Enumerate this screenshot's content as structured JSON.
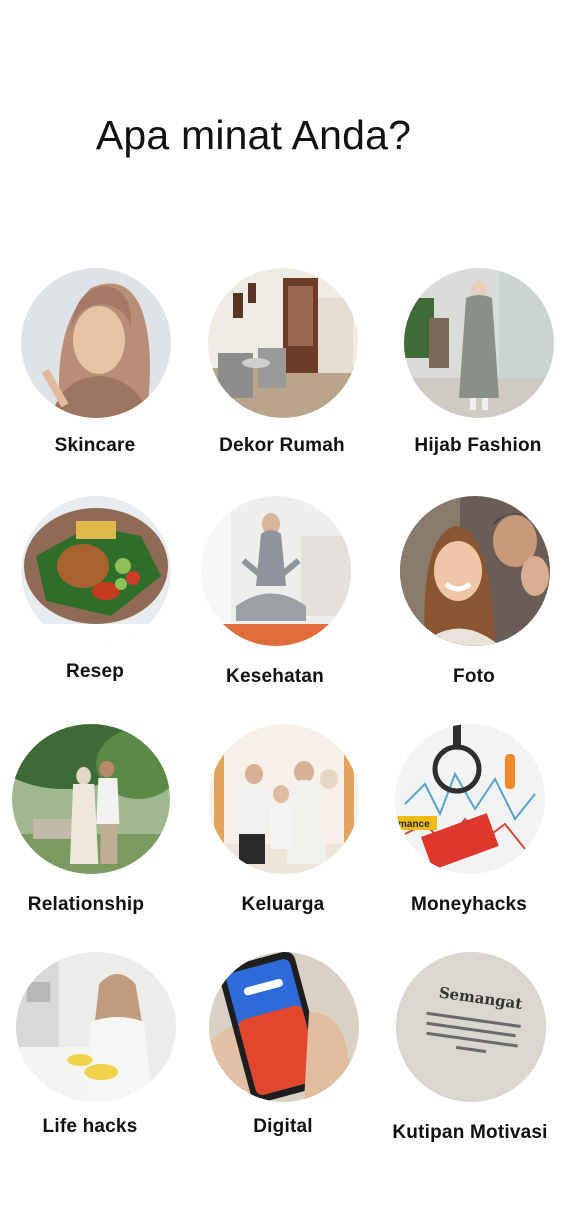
{
  "page": {
    "title": "Apa minat Anda?"
  },
  "interests": [
    {
      "label": "Skincare",
      "image": "woman-hijab-skincare-photo"
    },
    {
      "label": "Dekor Rumah",
      "image": "living-room-decor-photo"
    },
    {
      "label": "Hijab Fashion",
      "image": "hijab-fashion-model-photo"
    },
    {
      "label": "Resep",
      "image": "fried-chicken-dish-photo"
    },
    {
      "label": "Kesehatan",
      "image": "woman-meditating-photo"
    },
    {
      "label": "Foto",
      "image": "smiling-friends-photo"
    },
    {
      "label": "Relationship",
      "image": "couple-in-garden-photo"
    },
    {
      "label": "Keluarga",
      "image": "family-portrait-photo"
    },
    {
      "label": "Moneyhacks",
      "image": "finance-charts-magnifier-photo"
    },
    {
      "label": "Life hacks",
      "image": "woman-cleaning-kitchen-photo"
    },
    {
      "label": "Digital",
      "image": "smartphone-in-hand-photo"
    },
    {
      "label": "Kutipan Motivasi",
      "image": "semangat-quote-paper-photo"
    }
  ]
}
